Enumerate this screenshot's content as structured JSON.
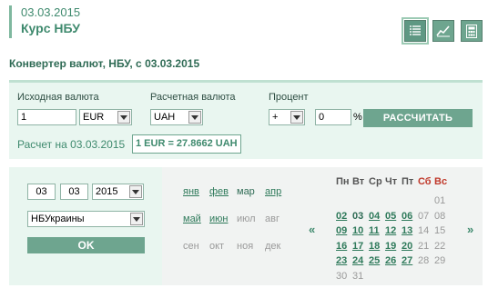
{
  "header": {
    "date": "03.03.2015",
    "title": "Курс НБУ"
  },
  "view_icons": [
    "list-icon",
    "chart-icon",
    "calculator-icon"
  ],
  "converter": {
    "title": "Конвертер валют, НБУ, с 03.03.2015",
    "source_label": "Исходная валюта",
    "target_label": "Расчетная валюта",
    "percent_label": "Процент",
    "amount_value": "1",
    "source_currency": "EUR",
    "target_currency": "UAH",
    "sign": "+",
    "percent_value": "0",
    "percent_sign": "%",
    "calc_button": "РАССЧИТАТЬ",
    "calc_on": "Расчет на 03.03.2015",
    "result": "1 EUR = 27.8662 UAH"
  },
  "date_picker": {
    "day": "03",
    "month": "03",
    "year": "2015",
    "source": "НБУкраины",
    "ok_button": "OK"
  },
  "months": [
    {
      "label": "янв",
      "active": true
    },
    {
      "label": "фев",
      "active": true
    },
    {
      "label": "мар",
      "active": false,
      "current": true
    },
    {
      "label": "апр",
      "active": true
    },
    {
      "label": "май",
      "active": true
    },
    {
      "label": "июн",
      "active": true
    },
    {
      "label": "июл",
      "active": false
    },
    {
      "label": "авг",
      "active": false
    },
    {
      "label": "сен",
      "active": false
    },
    {
      "label": "окт",
      "active": false
    },
    {
      "label": "ноя",
      "active": false
    },
    {
      "label": "дек",
      "active": false
    }
  ],
  "calendar": {
    "weekdays": [
      "Пн",
      "Вт",
      "Ср",
      "Чт",
      "Пт",
      "Сб",
      "Вс"
    ],
    "prev": "«",
    "next": "»",
    "weeks": [
      [
        "",
        "",
        "",
        "",
        "",
        "",
        "01"
      ],
      [
        "02",
        "03",
        "04",
        "05",
        "06",
        "07",
        "08"
      ],
      [
        "09",
        "10",
        "11",
        "12",
        "13",
        "14",
        "15"
      ],
      [
        "16",
        "17",
        "18",
        "19",
        "20",
        "21",
        "22"
      ],
      [
        "23",
        "24",
        "25",
        "26",
        "27",
        "28",
        "29"
      ],
      [
        "30",
        "31",
        "",
        "",
        "",
        "",
        ""
      ]
    ]
  }
}
